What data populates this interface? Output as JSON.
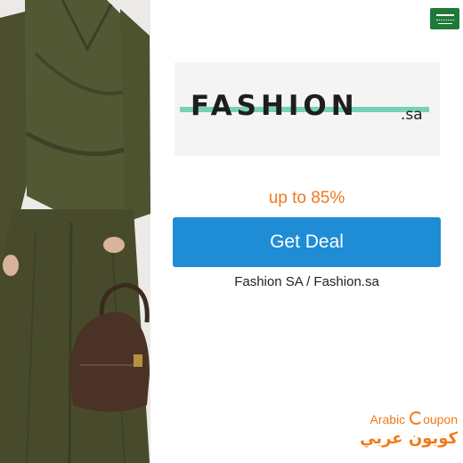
{
  "banner": {
    "photo_alt": "woman-in-olive-satin-outfit-with-brown-handbag",
    "flag_icon": "saudi-arabia-flag",
    "logo": {
      "word": "FASHION",
      "tld": ".sa",
      "stripe_color": "#76d1b8"
    },
    "discount_text": "up to 85%",
    "deal_button_label": "Get Deal",
    "store_name": "Fashion SA / Fashion.sa",
    "brand": {
      "english_prefix": "Arabic",
      "english_suffix": "oupon",
      "arabic": "كوبون عربي"
    }
  },
  "colors": {
    "accent_orange": "#f0771e",
    "button_blue": "#1f8cd6",
    "flag_green": "#1f7a3a",
    "outfit_olive": "#4a4d2c"
  }
}
